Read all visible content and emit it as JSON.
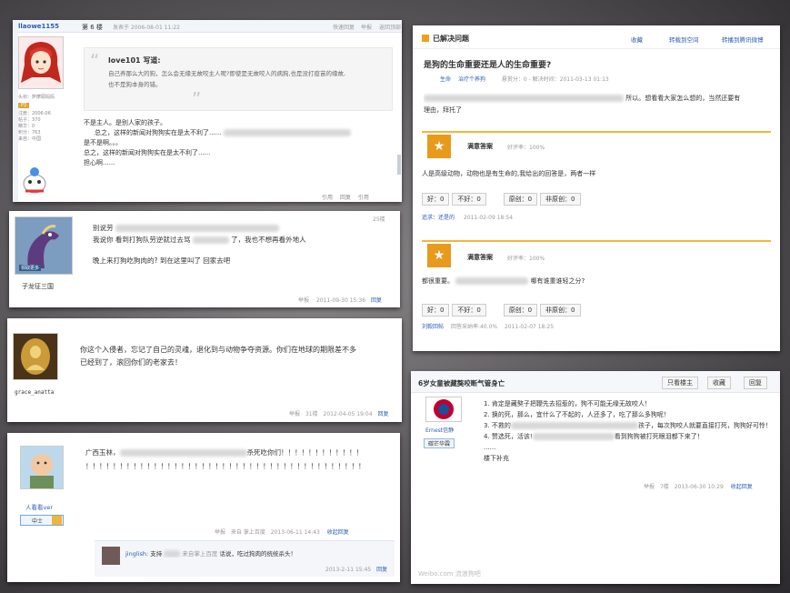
{
  "p1": {
    "user": "llaowe1155",
    "floor": "第 6 楼",
    "post_meta": "发表于 2006-08-01 11:22",
    "actions": [
      "快速回复",
      "举报",
      "返回顶部"
    ],
    "quote_author": "love101 写道:",
    "quote_l1": "自己养那么大的狗，怎么会无缘无故咬主人呢?即使是无故咬人的病狗,也是没打疫苗的缘故,",
    "quote_l2": "也不是狗本身的错。",
    "reply_l1": "不是主人。是别人家的孩子。",
    "reply_l2": "总之，这样的新闻对狗狗实在是太不利了......",
    "reply_l3": "是不是啊。。。",
    "reply_l4": "总之，这样的新闻对狗狗实在是太不利了......",
    "reply_l5": "担心啊......",
    "side_info": [
      "头衔：萨摩耶妈妈",
      "注册：2006-06",
      "帖子：370",
      "精华：0",
      "积分：763",
      "来自：中国"
    ],
    "footer": [
      "引用",
      "回复",
      "引用"
    ]
  },
  "p2": {
    "user": "子龙征三国",
    "badge": "领取更多",
    "floor": "25楼",
    "l1": "别说劳",
    "l2": "我说你  看到打狗队劳逆就过去骂",
    "l2b": "了，我也不想再看外地人",
    "l3": "晚上来打狗吃狗肉的?   到在这里叫了  回家去吧",
    "meta": "举报",
    "date": "2011-09-30 15:36",
    "reply": "回复"
  },
  "p3": {
    "user": "grace_anatta",
    "text_l1": "你这个入侵者，忘记了自己的灵魂，退化到与动物争夺资源。你们在地球的期限差不多",
    "text_l2": "已经到了，滚回你们的老家去！",
    "meta": "举报",
    "floor": "31楼",
    "date": "2012-04-05 19:04",
    "reply": "回复"
  },
  "p4": {
    "user": "人看看ver",
    "rank": "中士",
    "l1_start": "广西玉林，",
    "l1_end": "杀死吃你们！！！！！！！！！！！！",
    "l2": "！！！！！！！！！！！！！！！！！！！！！！！！！！！！！！！！！！！！！！！！！",
    "meta": "举报",
    "via": "来自 掌上百度",
    "date": "2013-06-11 14:43",
    "reply": "收起回复",
    "sub_user": "jinglish:",
    "sub_text": "支持",
    "sub_via": "来自掌上百度",
    "sub_text2": "话说，吃过狗肉的统统杀头！",
    "sub_date": "2013-2-11 15:45",
    "sub_reply": "回复"
  },
  "p5": {
    "solved": "已解决问题",
    "actions": [
      "收藏",
      "转载到空间",
      "转播到腾讯微博"
    ],
    "question": "是狗的生命重要还是人的生命重要?",
    "asker_meta": "悬赏分：0 - 解决时间：2011-03-13 01:13",
    "tags": [
      "生命",
      "治疗个养狗"
    ],
    "desc_l1": "所以。想看看大家怎么想的，当然还要有",
    "desc_l2": "理由，拜托了",
    "answer_label": "满意答案",
    "answer_rate": "好评率：100%",
    "answer_text": "人是高级动物，动物也是有生命的,我给出的回答是，两者一样",
    "vote": [
      "好：0",
      "不好：0",
      "原创：0",
      "非原创：0"
    ],
    "answer_user": "追求：还是的",
    "answer_date": "2011-02-09 18:54",
    "answer2_label": "满意答案",
    "answer2_rate": "好评率：100%",
    "answer2_text": "都很重要。",
    "answer2_text_end": "哪有谁重谁轻之分?",
    "vote2": [
      "好：0",
      "不好：0",
      "原创：0",
      "非原创：0"
    ],
    "answer2_user": "刘毅回帖",
    "answer2_meta": "回答采纳率:40.0%",
    "answer2_date": "2011-02-07 18:25"
  },
  "p6": {
    "title": "6岁女童被藏獒咬断气管身亡",
    "buttons": [
      "只看楼主",
      "收藏",
      "回复"
    ],
    "user": "Ernest信静",
    "badge": "碳芒华霖",
    "items": [
      "1. 肯定是藏獒子把鞭先去招惹的，狗不可能无缘无故咬人！",
      "2. 换的死，那么，宜什么了不起的，人还多了，吃了那么多狗呢！",
      "3. 不救的",
      "4. 赞选死，活该!",
      "......",
      "楼下补充"
    ],
    "items_tail": [
      "孩子，每次狗咬人就要直接打死，狗狗好可怜！",
      "看到狗狗被打死眼泪都下来了！"
    ],
    "meta": "举报",
    "floor": "7楼",
    "date": "2013-06-30 10:29",
    "reply": "收起回复",
    "watermark": "Weibo.com 流浪狗吧"
  }
}
